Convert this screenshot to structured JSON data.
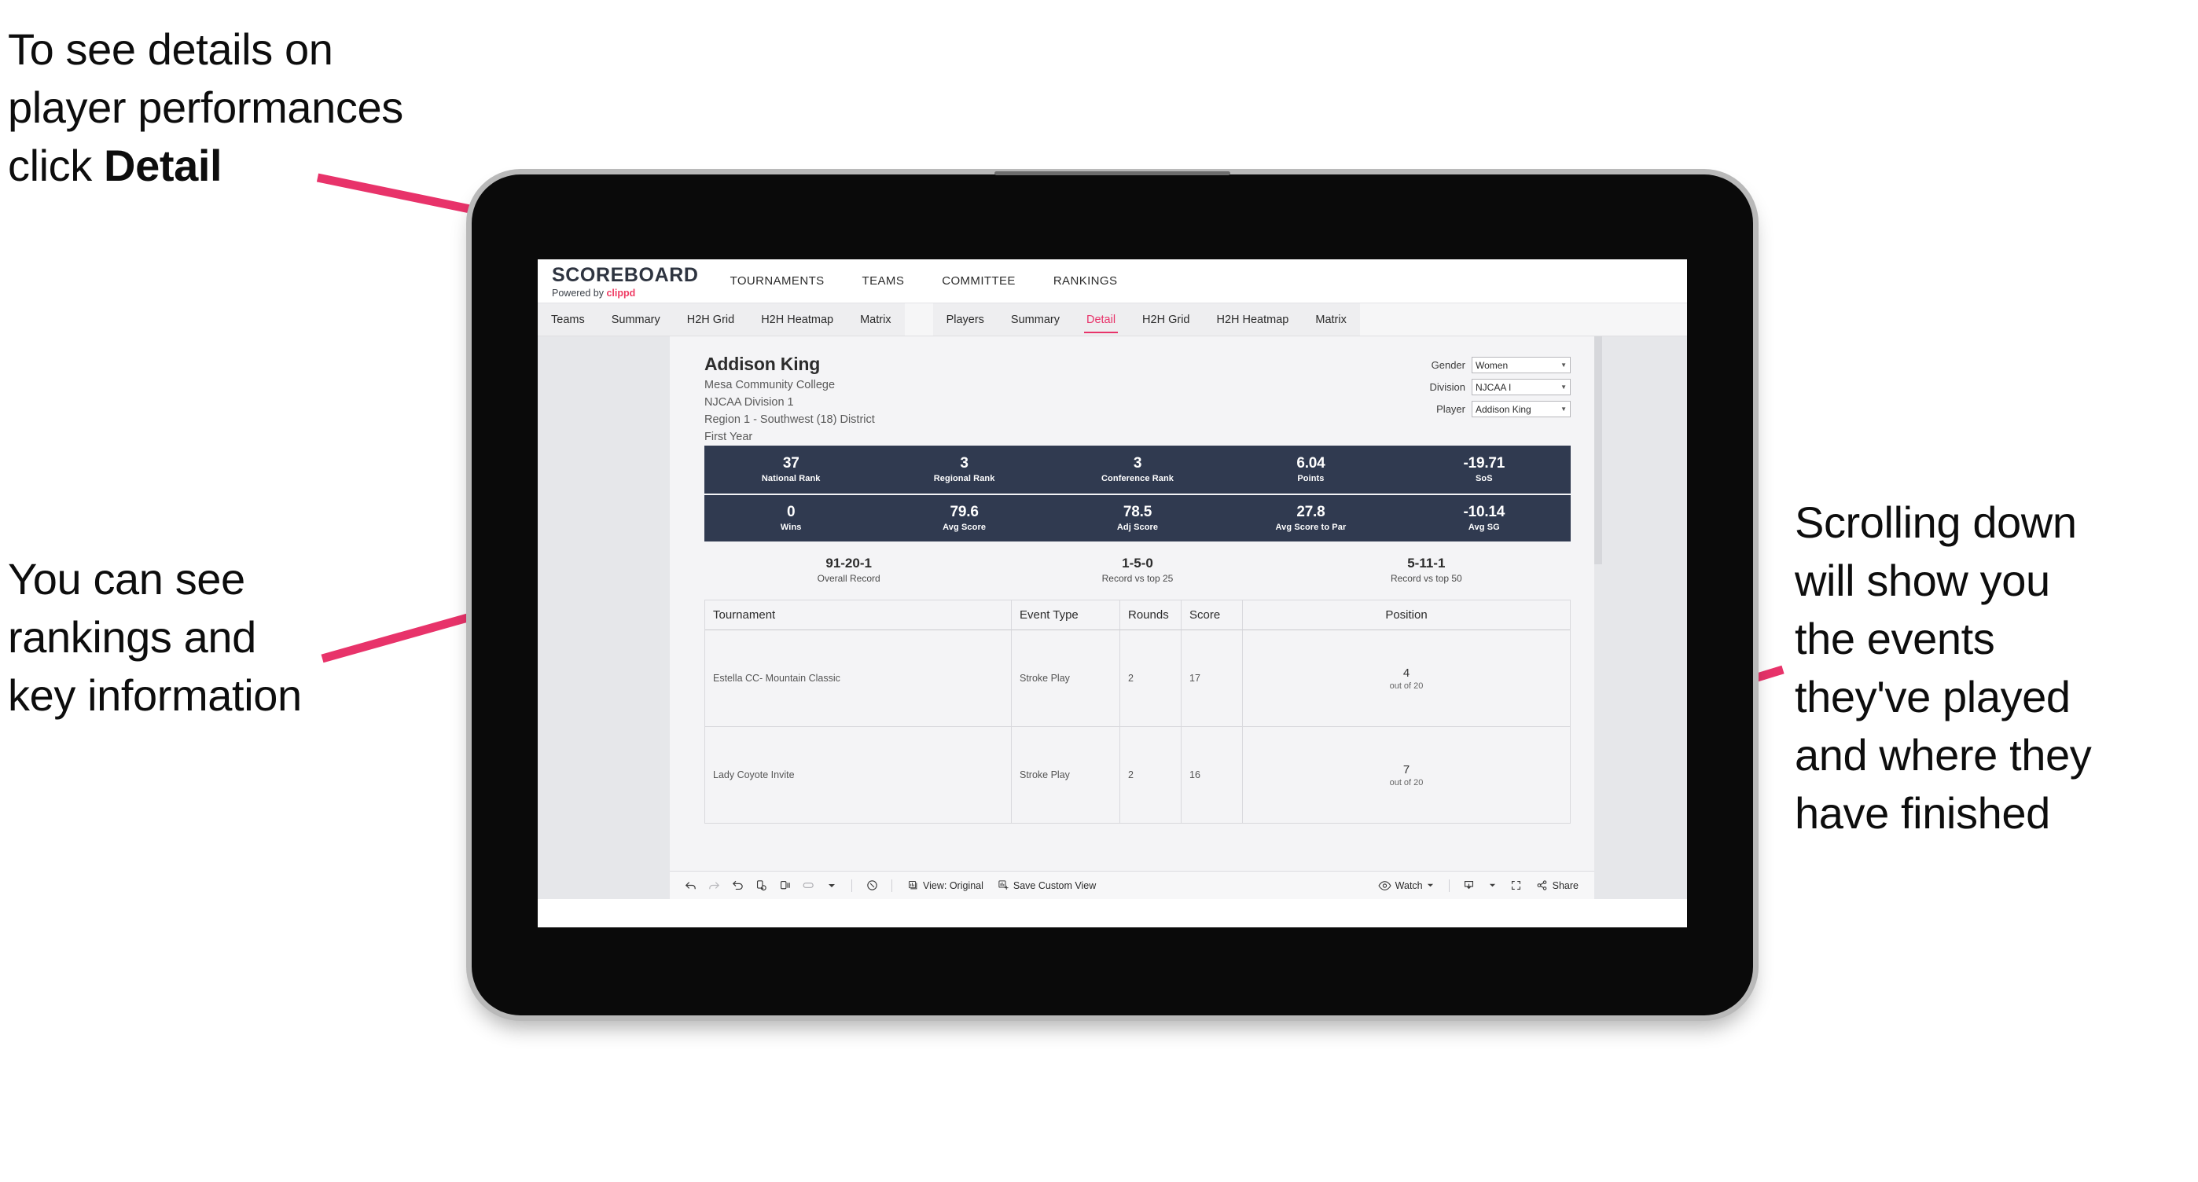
{
  "annotations": {
    "top_left": "To see details on\nplayer performances\nclick ",
    "top_left_bold": "Detail",
    "mid_left": "You can see\nrankings and\nkey information",
    "right": "Scrolling down\nwill show you\nthe events\nthey've played\nand where they\nhave finished"
  },
  "colors": {
    "accent_pink": "#e8336a",
    "stat_bar_navy": "#303a50",
    "brand_red": "#ef3b63"
  },
  "app": {
    "logo": {
      "title": "SCOREBOARD",
      "powered_prefix": "Powered by ",
      "brand": "clippd"
    },
    "top_nav": [
      "TOURNAMENTS",
      "TEAMS",
      "COMMITTEE",
      "RANKINGS"
    ],
    "tab_groups": [
      {
        "name": "teams-group",
        "tabs": [
          {
            "label": "Teams",
            "active": false
          },
          {
            "label": "Summary",
            "active": false
          },
          {
            "label": "H2H Grid",
            "active": false
          },
          {
            "label": "H2H Heatmap",
            "active": false
          },
          {
            "label": "Matrix",
            "active": false
          }
        ]
      },
      {
        "name": "players-group",
        "tabs": [
          {
            "label": "Players",
            "active": false
          },
          {
            "label": "Summary",
            "active": false
          },
          {
            "label": "Detail",
            "active": true
          },
          {
            "label": "H2H Grid",
            "active": false
          },
          {
            "label": "H2H Heatmap",
            "active": false
          },
          {
            "label": "Matrix",
            "active": false
          }
        ]
      }
    ]
  },
  "player": {
    "name": "Addison King",
    "school": "Mesa Community College",
    "division": "NJCAA Division 1",
    "region": "Region 1 - Southwest (18) District",
    "year": "First Year"
  },
  "filters": [
    {
      "label": "Gender",
      "value": "Women"
    },
    {
      "label": "Division",
      "value": "NJCAA I"
    },
    {
      "label": "Player",
      "value": "Addison King"
    }
  ],
  "stats_row_1": [
    {
      "value": "37",
      "label": "National Rank"
    },
    {
      "value": "3",
      "label": "Regional Rank"
    },
    {
      "value": "3",
      "label": "Conference Rank"
    },
    {
      "value": "6.04",
      "label": "Points"
    },
    {
      "value": "-19.71",
      "label": "SoS"
    }
  ],
  "stats_row_2": [
    {
      "value": "0",
      "label": "Wins"
    },
    {
      "value": "79.6",
      "label": "Avg Score"
    },
    {
      "value": "78.5",
      "label": "Adj Score"
    },
    {
      "value": "27.8",
      "label": "Avg Score to Par"
    },
    {
      "value": "-10.14",
      "label": "Avg SG"
    }
  ],
  "records": [
    {
      "value": "91-20-1",
      "label": "Overall Record"
    },
    {
      "value": "1-5-0",
      "label": "Record vs top 25"
    },
    {
      "value": "5-11-1",
      "label": "Record vs top 50"
    }
  ],
  "table": {
    "headers": [
      "Tournament",
      "Event Type",
      "Rounds",
      "Score",
      "Position"
    ],
    "rows": [
      {
        "tournament": "Estella CC- Mountain Classic",
        "event_type": "Stroke Play",
        "rounds": "2",
        "score": "17",
        "position": "4",
        "position_sub": "out of 20"
      },
      {
        "tournament": "Lady Coyote Invite",
        "event_type": "Stroke Play",
        "rounds": "2",
        "score": "16",
        "position": "7",
        "position_sub": "out of 20"
      }
    ]
  },
  "toolbar": {
    "view_label": "View: Original",
    "save_custom_view_label": "Save Custom View",
    "watch_label": "Watch",
    "share_label": "Share"
  }
}
